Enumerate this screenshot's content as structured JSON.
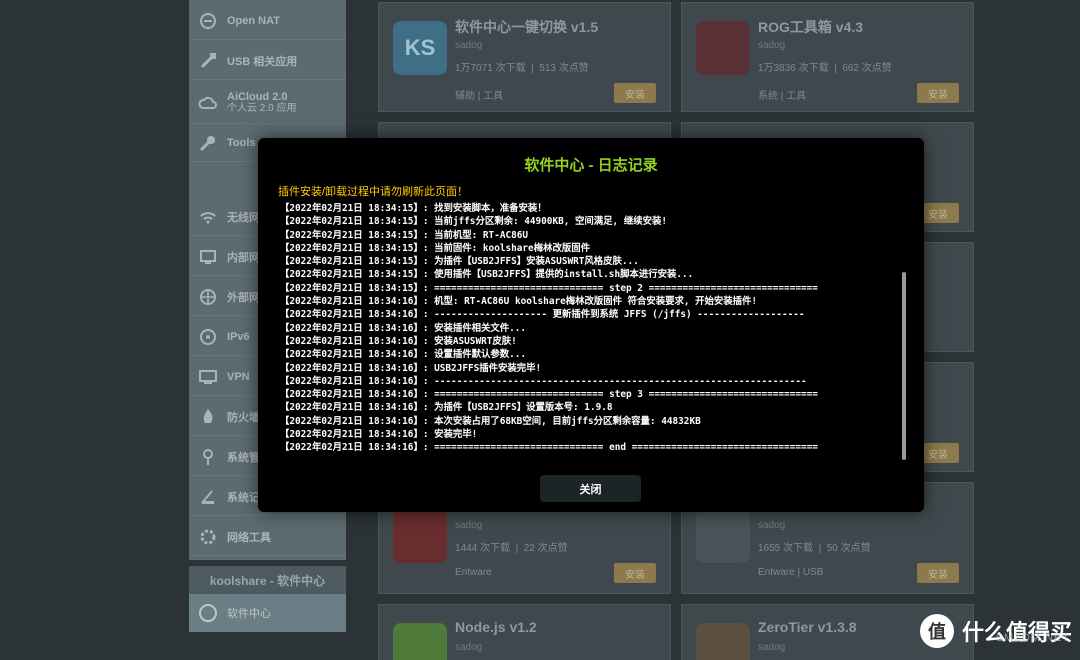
{
  "sidebar": {
    "items": [
      {
        "label": "Open NAT",
        "icon": "gamepad-icon"
      },
      {
        "label": "USB 相关应用",
        "icon": "usb-icon"
      },
      {
        "label": "AiCloud 2.0",
        "sub": "个人云 2.0 应用",
        "icon": "cloud-icon"
      },
      {
        "label": "Tools",
        "icon": "wrench-icon"
      },
      {
        "label": "无线网络",
        "icon": "wifi-icon"
      },
      {
        "label": "内部网络",
        "icon": "lan-icon"
      },
      {
        "label": "外部网络",
        "icon": "globe-icon"
      },
      {
        "label": "IPv6",
        "icon": "ipv6-icon"
      },
      {
        "label": "VPN",
        "icon": "vpn-icon"
      },
      {
        "label": "防火墙",
        "icon": "firewall-icon"
      },
      {
        "label": "系统管理",
        "icon": "admin-icon"
      },
      {
        "label": "系统记录",
        "icon": "log-icon"
      },
      {
        "label": "网络工具",
        "icon": "tools-icon"
      }
    ],
    "section_title": "koolshare - 软件中心",
    "section_item": "软件中心"
  },
  "cards": [
    {
      "name": "软件中心一键切换 v1.5",
      "author": "sadog",
      "downloads": "1万7071 次下载",
      "likes": "513 次点赞",
      "tags": "辅助 | 工具",
      "logo_text": "KS"
    },
    {
      "name": "ROG工具箱 v4.3",
      "author": "sadog",
      "downloads": "1万3836 次下载",
      "likes": "662 次点赞",
      "tags": "系统 | 工具"
    },
    {
      "name": "",
      "author": "sadog",
      "downloads": "1444 次下载",
      "likes": "22 次点赞",
      "tags": "Entware"
    },
    {
      "name": "",
      "author": "sadog",
      "downloads": "1655 次下载",
      "likes": "50 次点赞",
      "tags": "Entware | USB"
    },
    {
      "name": "Node.js v1.2",
      "author": "sadog"
    },
    {
      "name": "ZeroTier v1.3.8",
      "author": "sadog"
    }
  ],
  "card_button_label": "安装",
  "watermark": {
    "text": "什么值得买",
    "sub": "SMZDM.NET",
    "logo": "值"
  },
  "modal": {
    "title": "软件中心 - 日志记录",
    "warning": "插件安装/卸载过程中请勿刷新此页面！",
    "close_label": "关闭",
    "log": [
      "【2022年02月21日 18:34:15】: 找到安装脚本，准备安装！",
      "【2022年02月21日 18:34:15】: 当前jffs分区剩余: 44900KB, 空间满足, 继续安装!",
      "【2022年02月21日 18:34:15】: 当前机型: RT-AC86U",
      "【2022年02月21日 18:34:15】: 当前固件: koolshare梅林改版固件",
      "【2022年02月21日 18:34:15】: 为插件【USB2JFFS】安装ASUSWRT风格皮肤...",
      "【2022年02月21日 18:34:15】: 使用插件【USB2JFFS】提供的install.sh脚本进行安装...",
      "【2022年02月21日 18:34:15】: ============================== step 2 ==============================",
      "【2022年02月21日 18:34:16】: 机型: RT-AC86U koolshare梅林改版固件 符合安装要求, 开始安装插件!",
      "【2022年02月21日 18:34:16】: -------------------- 更新插件到系统 JFFS (/jffs) -------------------",
      "【2022年02月21日 18:34:16】: 安装插件相关文件...",
      "【2022年02月21日 18:34:16】: 安装ASUSWRT皮肤!",
      "【2022年02月21日 18:34:16】: 设置插件默认参数...",
      "【2022年02月21日 18:34:16】: USB2JFFS插件安装完毕!",
      "【2022年02月21日 18:34:16】: ------------------------------------------------------------------",
      "【2022年02月21日 18:34:16】: ============================== step 3 ==============================",
      "【2022年02月21日 18:34:16】: 为插件【USB2JFFS】设置版本号: 1.9.8",
      "【2022年02月21日 18:34:16】: 本次安装占用了68KB空间, 目前jffs分区剩余容量: 44832KB",
      "【2022年02月21日 18:34:16】: 安装完毕!",
      "【2022年02月21日 18:34:16】: ============================== end ================================="
    ]
  }
}
